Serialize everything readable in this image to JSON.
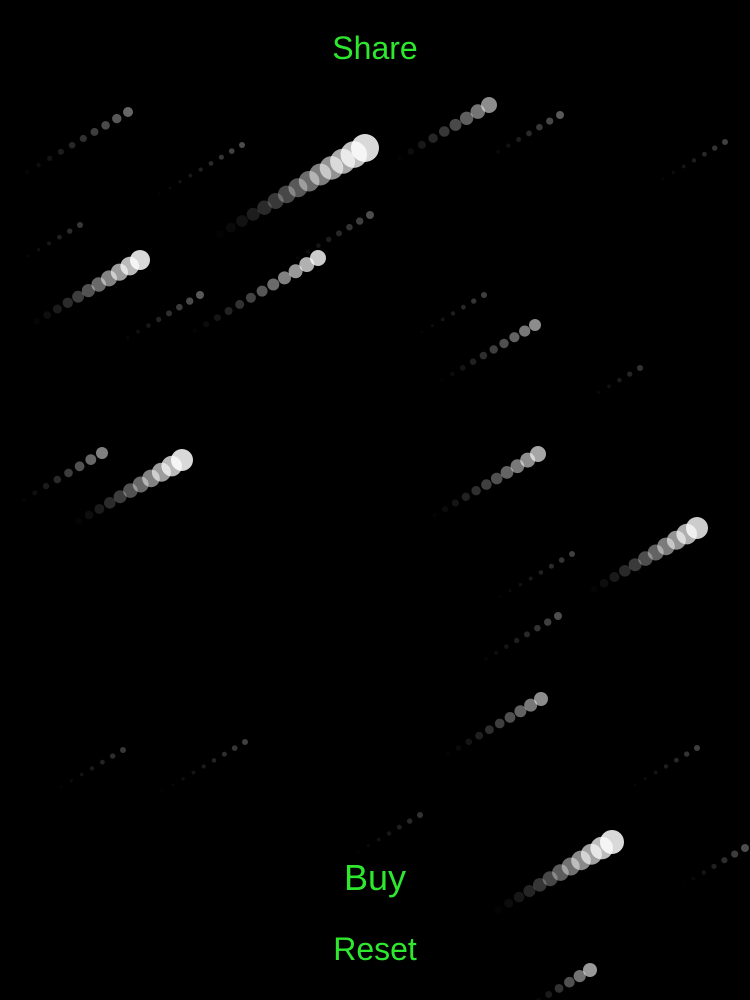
{
  "screen": {
    "background_color": "#000000",
    "accent_color": "#2ee82e",
    "particle_color": "#ffffff"
  },
  "buttons": {
    "share_label": "Share",
    "buy_label": "Buy",
    "reset_label": "Reset"
  },
  "scene": {
    "trail_count": 24,
    "trail_direction": "down-left"
  }
}
